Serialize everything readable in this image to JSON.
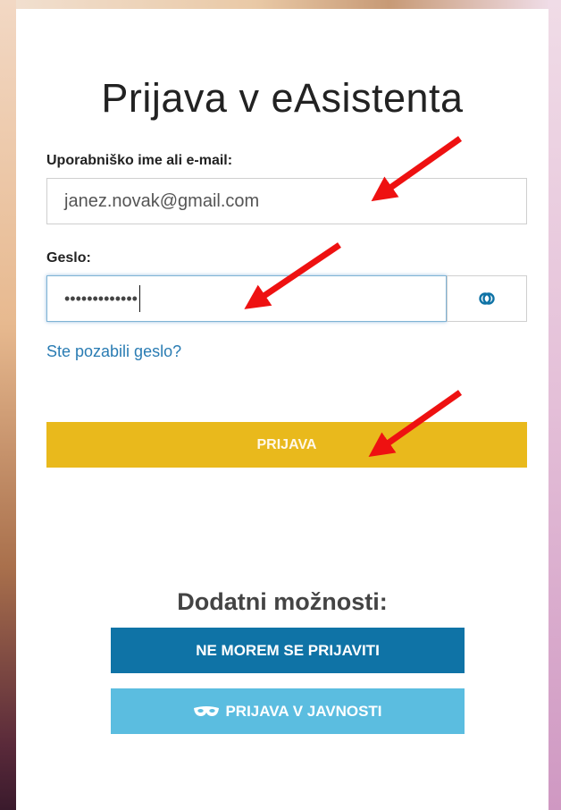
{
  "login": {
    "title": "Prijava v eAsistenta",
    "username_label": "Uporabniško ime ali e-mail:",
    "username_value": "janez.novak@gmail.com",
    "password_label": "Geslo:",
    "password_value": "•••••••••••••",
    "forgot_link": "Ste pozabili geslo?",
    "submit_label": "PRIJAVA"
  },
  "extra": {
    "heading": "Dodatni možnosti:",
    "cannot_login_label": "NE MOREM SE PRIJAVITI",
    "public_login_label": "PRIJAVA V JAVNOSTI"
  },
  "icons": {
    "eye": "eye-icon",
    "mask": "mask-icon",
    "annotation": "red-arrow-icon"
  },
  "colors": {
    "accent_yellow": "#e9b91c",
    "primary_blue": "#0f73a6",
    "light_blue": "#5bbde0",
    "link_blue": "#2a7cb3",
    "arrow_red": "#ee1111"
  }
}
